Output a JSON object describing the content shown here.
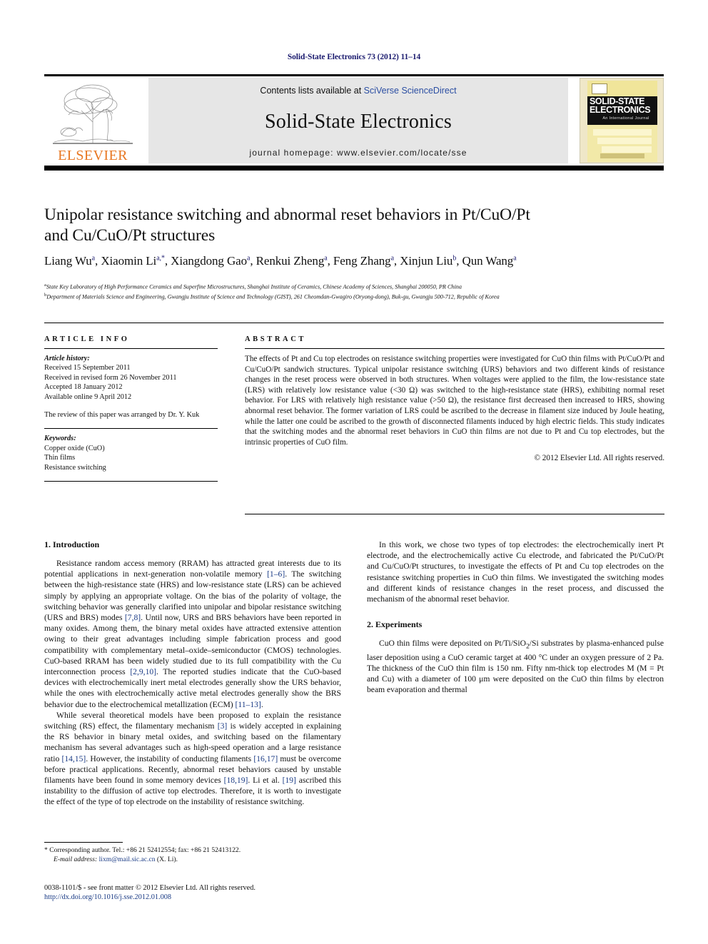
{
  "running_head": "Solid-State Electronics 73 (2012) 11–14",
  "masthead": {
    "contents_prefix": "Contents lists available at ",
    "contents_link": "SciVerse ScienceDirect",
    "journal_name": "Solid-State Electronics",
    "homepage": "journal homepage: www.elsevier.com/locate/sse",
    "publisher_wordmark": "ELSEVIER",
    "cover": {
      "line1": "SOLID-STATE",
      "line2": "ELECTRONICS",
      "subtitle": "An International Journal"
    }
  },
  "article": {
    "title_line1": "Unipolar resistance switching and abnormal reset behaviors in Pt/CuO/Pt",
    "title_line2": "and Cu/CuO/Pt structures",
    "authors": "Liang Wu a, Xiaomin Li a,*, Xiangdong Gao a, Renkui Zheng a, Feng Zhang a, Xinjun Liu b, Qun Wang a",
    "affiliation_a": "State Key Laboratory of High Performance Ceramics and Superfine Microstructures, Shanghai Institute of Ceramics, Chinese Academy of Sciences, Shanghai 200050, PR China",
    "affiliation_b": "Department of Materials Science and Engineering, Gwangju Institute of Science and Technology (GIST), 261 Cheomdan-Gwagiro (Oryong-dong), Buk-gu, Gwangju 500-712, Republic of Korea"
  },
  "info": {
    "heading": "ARTICLE INFO",
    "history_label": "Article history:",
    "history": [
      "Received 15 September 2011",
      "Received in revised form 26 November 2011",
      "Accepted 18 January 2012",
      "Available online 9 April 2012"
    ],
    "review_note": "The review of this paper was arranged by Dr. Y. Kuk",
    "keywords_label": "Keywords:",
    "keywords": [
      "Copper oxide (CuO)",
      "Thin films",
      "Resistance switching"
    ]
  },
  "abstract": {
    "heading": "ABSTRACT",
    "text": "The effects of Pt and Cu top electrodes on resistance switching properties were investigated for CuO thin films with Pt/CuO/Pt and Cu/CuO/Pt sandwich structures. Typical unipolar resistance switching (URS) behaviors and two different kinds of resistance changes in the reset process were observed in both structures. When voltages were applied to the film, the low-resistance state (LRS) with relatively low resistance value (<30 Ω) was switched to the high-resistance state (HRS), exhibiting normal reset behavior. For LRS with relatively high resistance value (>50 Ω), the resistance first decreased then increased to HRS, showing abnormal reset behavior. The former variation of LRS could be ascribed to the decrease in filament size induced by Joule heating, while the latter one could be ascribed to the growth of disconnected filaments induced by high electric fields. This study indicates that the switching modes and the abnormal reset behaviors in CuO thin films are not due to Pt and Cu top electrodes, but the intrinsic properties of CuO film.",
    "copyright": "© 2012 Elsevier Ltd. All rights reserved."
  },
  "sections": {
    "introduction_heading": "1. Introduction",
    "intro_p1": "Resistance random access memory (RRAM) has attracted great interests due to its potential applications in next-generation non-volatile memory [1–6]. The switching between the high-resistance state (HRS) and low-resistance state (LRS) can be achieved simply by applying an appropriate voltage. On the bias of the polarity of voltage, the switching behavior was generally clarified into unipolar and bipolar resistance switching (URS and BRS) modes [7,8]. Until now, URS and BRS behaviors have been reported in many oxides. Among them, the binary metal oxides have attracted extensive attention owing to their great advantages including simple fabrication process and good compatibility with complementary metal–oxide–semiconductor (CMOS) technologies. CuO-based RRAM has been widely studied due to its full compatibility with the Cu interconnection process [2,9,10]. The reported studies indicate that the CuO-based devices with electrochemically inert metal electrodes generally show the URS behavior, while the ones with electrochemically active metal electrodes generally show the BRS behavior due to the electrochemical metallization (ECM) [11–13].",
    "intro_p2": "While several theoretical models have been proposed to explain the resistance switching (RS) effect, the filamentary mechanism [3] is widely accepted in explaining the RS behavior in binary metal oxides, and switching based on the filamentary mechanism has several advantages such as high-speed operation and a large resistance ratio [14,15]. However, the instability of conducting filaments [16,17] must be overcome before practical applications. Recently, abnormal reset behaviors caused by unstable filaments have been found in some memory devices [18,19]. Li et al. [19] ascribed this instability to the diffusion of active top electrodes. Therefore, it is worth to investigate the effect of the type of top electrode on the instability of resistance switching.",
    "intro_p3": "In this work, we chose two types of top electrodes: the electrochemically inert Pt electrode, and the electrochemically active Cu electrode, and fabricated the Pt/CuO/Pt and Cu/CuO/Pt structures, to investigate the effects of Pt and Cu top electrodes on the resistance switching properties in CuO thin films. We investigated the switching modes and different kinds of resistance changes in the reset process, and discussed the mechanism of the abnormal reset behavior.",
    "experiments_heading": "2. Experiments",
    "exp_p1": "CuO thin films were deposited on Pt/Ti/SiO2/Si substrates by plasma-enhanced pulse laser deposition using a CuO ceramic target at 400 °C under an oxygen pressure of 2 Pa. The thickness of the CuO thin film is 150 nm. Fifty nm-thick top electrodes M (M = Pt and Cu) with a diameter of 100 μm were deposited on the CuO thin films by electron beam evaporation and thermal"
  },
  "footnotes": {
    "corresponding": "* Corresponding author. Tel.: +86 21 52412554; fax: +86 21 52413122.",
    "email_label": "E-mail address:",
    "email": "lixm@mail.sic.ac.cn",
    "email_suffix": " (X. Li).",
    "issn_line": "0038-1101/$ - see front matter © 2012 Elsevier Ltd. All rights reserved.",
    "doi": "http://dx.doi.org/10.1016/j.sse.2012.01.008"
  },
  "colors": {
    "running_head": "#1a1a6e",
    "link": "#2b4ea2",
    "reference": "#1a3b85",
    "elsevier_orange": "#E87722",
    "band_bg": "#e6e6e6"
  }
}
